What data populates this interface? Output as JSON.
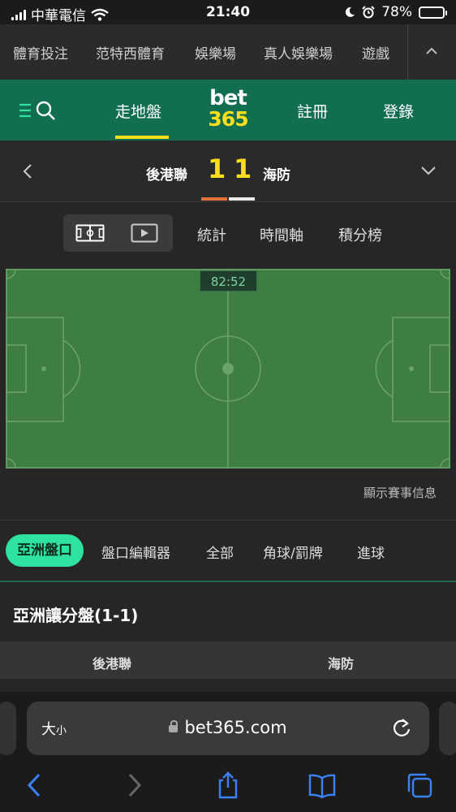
{
  "status": {
    "carrier": "中華電信",
    "time": "21:40",
    "battery": "78%",
    "battery_level": 0.78
  },
  "topnav": {
    "items": [
      "體育投注",
      "范特西體育",
      "娛樂場",
      "真人娛樂場",
      "遊戲"
    ],
    "collapse_icon": "chevron-up-icon"
  },
  "header": {
    "inplay_label": "走地盤",
    "logo_top": "bet",
    "logo_bottom": "365",
    "register_label": "註冊",
    "login_label": "登錄"
  },
  "match": {
    "home": "後港聯",
    "away": "海防",
    "home_score": "1",
    "away_score": "1"
  },
  "view_tabs": {
    "stats": "統計",
    "timeline": "時間軸",
    "standings": "積分榜"
  },
  "pitch": {
    "clock": "82:52",
    "show_info": "顯示賽事信息"
  },
  "market_tabs": {
    "active": "亞洲盤口",
    "items": [
      "盤口編輯器",
      "全部",
      "角球/罰牌",
      "進球"
    ]
  },
  "market": {
    "title": "亞洲讓分盤(1-1)",
    "col_home": "後港聯",
    "col_away": "海防"
  },
  "browser": {
    "text_size_big": "大",
    "text_size_small": "小",
    "url": "bet365.com"
  },
  "colors": {
    "brand_green": "#126e51",
    "brand_yellow": "#ffdf1b",
    "accent_mint": "#2ee3a0",
    "pitch_green": "#3f7e41"
  }
}
